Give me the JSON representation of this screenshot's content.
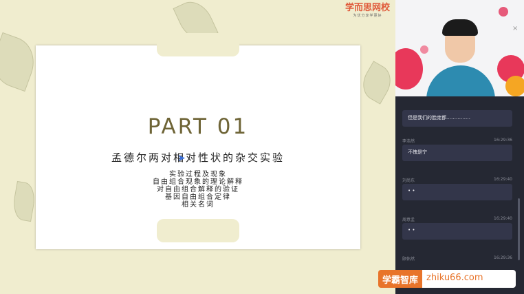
{
  "slide": {
    "logo_main": "学而思网校",
    "logo_sub": "为优分享学更好",
    "title": "PART 01",
    "subtitle": "孟德尔两对相对性状的杂交实验",
    "topics": [
      "实验过程及现象",
      "自由组合现象的理论解释",
      "对自由组合解释的验证",
      "基因自由组合定律",
      "相关名词"
    ]
  },
  "video": {
    "close_icon": "×"
  },
  "chat": {
    "messages": [
      {
        "user": "",
        "time": "",
        "text": "但是我们的脸庞都……………"
      },
      {
        "user": "李浩然",
        "time": "16:29:36",
        "text": "不愧是宁"
      },
      {
        "user": "刘尚东",
        "time": "16:29:40",
        "text": "• •"
      },
      {
        "user": "周意孟",
        "time": "16:29:40",
        "text": "• •"
      },
      {
        "user": "顾佑然",
        "time": "16:29:36",
        "text": ""
      }
    ]
  },
  "watermark": {
    "left": "学霸智库",
    "right": "zhiku66.com"
  },
  "colors": {
    "slide_bg": "#f0edcf",
    "title": "#6e6436",
    "panel_bg": "#252833",
    "bubble_bg": "#33364a",
    "logo": "#e05a3a",
    "watermark": "#e8742a"
  }
}
